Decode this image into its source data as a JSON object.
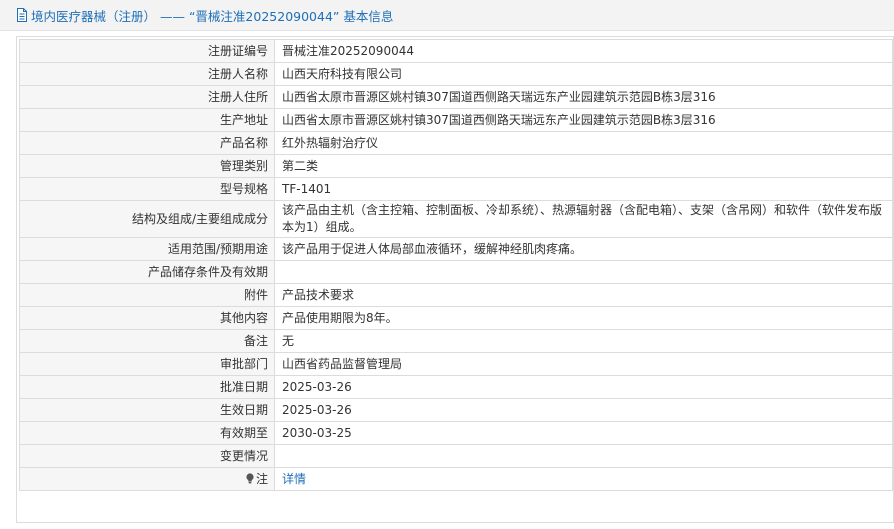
{
  "header": {
    "title": "境内医疗器械（注册） —— “晋械注准20252090044” 基本信息"
  },
  "rows": [
    {
      "label": "注册证编号",
      "value": "晋械注准20252090044"
    },
    {
      "label": "注册人名称",
      "value": "山西天府科技有限公司"
    },
    {
      "label": "注册人住所",
      "value": "山西省太原市晋源区姚村镇307国道西侧路天瑞远东产业园建筑示范园B栋3层316"
    },
    {
      "label": "生产地址",
      "value": "山西省太原市晋源区姚村镇307国道西侧路天瑞远东产业园建筑示范园B栋3层316"
    },
    {
      "label": "产品名称",
      "value": "红外热辐射治疗仪"
    },
    {
      "label": "管理类别",
      "value": "第二类"
    },
    {
      "label": "型号规格",
      "value": "TF-1401"
    },
    {
      "label": "结构及组成/主要组成成分",
      "value": "该产品由主机（含主控箱、控制面板、冷却系统）、热源辐射器（含配电箱）、支架（含吊网）和软件（软件发布版本为1）组成。"
    },
    {
      "label": "适用范围/预期用途",
      "value": "该产品用于促进人体局部血液循环，缓解神经肌肉疼痛。"
    },
    {
      "label": "产品储存条件及有效期",
      "value": ""
    },
    {
      "label": "附件",
      "value": "产品技术要求"
    },
    {
      "label": "其他内容",
      "value": "产品使用期限为8年。"
    },
    {
      "label": "备注",
      "value": "无"
    },
    {
      "label": "审批部门",
      "value": "山西省药品监督管理局"
    },
    {
      "label": "批准日期",
      "value": "2025-03-26"
    },
    {
      "label": "生效日期",
      "value": "2025-03-26"
    },
    {
      "label": "有效期至",
      "value": "2030-03-25"
    },
    {
      "label": "变更情况",
      "value": ""
    }
  ],
  "note_row": {
    "label": "注",
    "link_text": "详情"
  },
  "icons": {
    "header": "document-icon",
    "note": "lightbulb-icon"
  },
  "colors": {
    "link": "#1f6fb7",
    "label_bg": "#f6f6f6",
    "border": "#dcdcdc"
  }
}
